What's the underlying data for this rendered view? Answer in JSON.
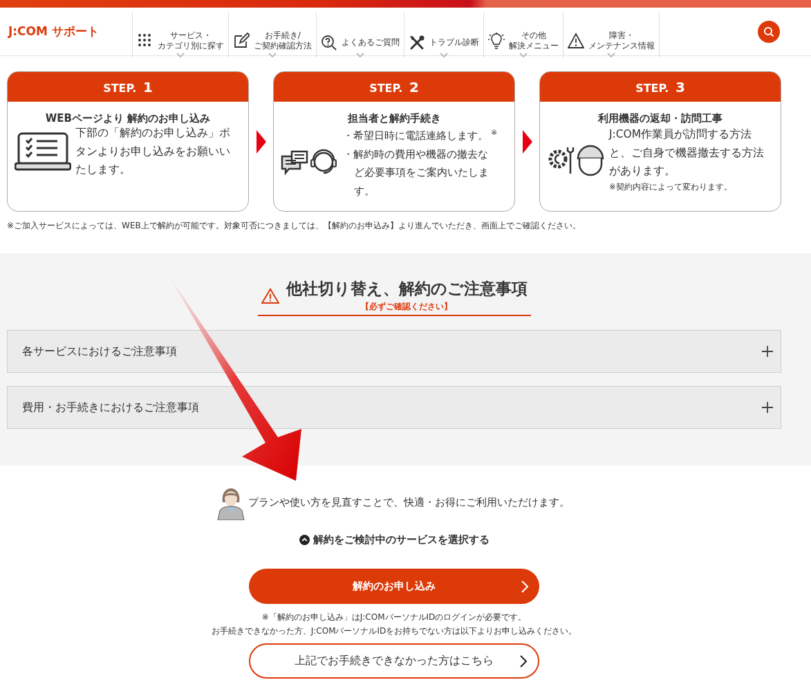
{
  "header": {
    "logo": "J:COM サポート",
    "nav": [
      {
        "lines": [
          "サービス・",
          "カテゴリ別に探す"
        ]
      },
      {
        "lines": [
          "お手続き/",
          "ご契約確認方法"
        ]
      },
      {
        "lines": [
          "よくあるご質問"
        ]
      },
      {
        "lines": [
          "トラブル診断"
        ]
      },
      {
        "lines": [
          "その他",
          "解決メニュー"
        ]
      },
      {
        "lines": [
          "障害・",
          "メンテナンス情報"
        ]
      }
    ]
  },
  "steps": [
    {
      "badge": "STEP.",
      "number": "1",
      "title": "WEBページより 解約のお申し込み",
      "lines": [
        "下部の「解約のお申し込み」ボタンよりお申し込みをお願いいたします。"
      ]
    },
    {
      "badge": "STEP.",
      "number": "2",
      "title": "担当者と解約手続き",
      "bullets": [
        "・希望日時に電話連絡します。",
        "・解約時の費用や機器の撤去など必要事項をご案内いたします。"
      ],
      "mark": "※"
    },
    {
      "badge": "STEP.",
      "number": "3",
      "title": "利用機器の返却・訪問工事",
      "lines": [
        "J:COM作業員が訪問する方法と、ご自身で機器撤去する方法があります。"
      ],
      "note": "※契約内容によって変わります。"
    }
  ],
  "steps_note": "※ご加入サービスによっては、WEB上で解約が可能です。対象可否につきましては、【解約のお申込み】より進んでいただき、画面上でご確認ください。",
  "caution": {
    "title": "他社切り替え、解約のご注意事項",
    "subtitle": "【必ずご確認ください】",
    "accordions": [
      {
        "label": "各サービスにおけるご注意事項",
        "expanded": false
      },
      {
        "label": "費用・お手続きにおけるご注意事項",
        "expanded": false
      }
    ]
  },
  "advice": "プランや使い方を見直すことで、快適・お得にご利用いただけます。",
  "service_toggle": {
    "label": "解約をご検討中のサービスを選択する",
    "expanded": true
  },
  "apply_button": "解約のお申し込み",
  "notes": [
    "※「解約のお申し込み」はJ:COMパーソナルIDのログインが必要です。",
    "お手続きできなかった方、J:COMパーソナルIDをお持ちでない方は以下よりお申し込みください。"
  ],
  "alt_button": "上記でお手続きできなかった方はこちら"
}
